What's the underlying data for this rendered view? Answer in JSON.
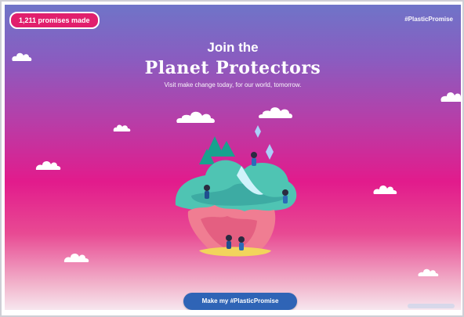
{
  "header": {
    "promises_badge": "1,211 promises made",
    "hashtag": "#PlasticPromise"
  },
  "hero": {
    "title_line1": "Join the",
    "title_line2": "Planet Protectors",
    "subtitle": "Visit make change today, for our world, tomorrow."
  },
  "cta": {
    "label": "Make my #PlasticPromise"
  },
  "icons": {
    "cloud": "cloud-icon",
    "island": "floating-island-illustration"
  },
  "colors": {
    "gradient_top": "#6f74c8",
    "gradient_mid": "#e21b8c",
    "gradient_bottom": "#f7e7ef",
    "badge": "#e11f6d",
    "cta": "#2f64b6"
  }
}
